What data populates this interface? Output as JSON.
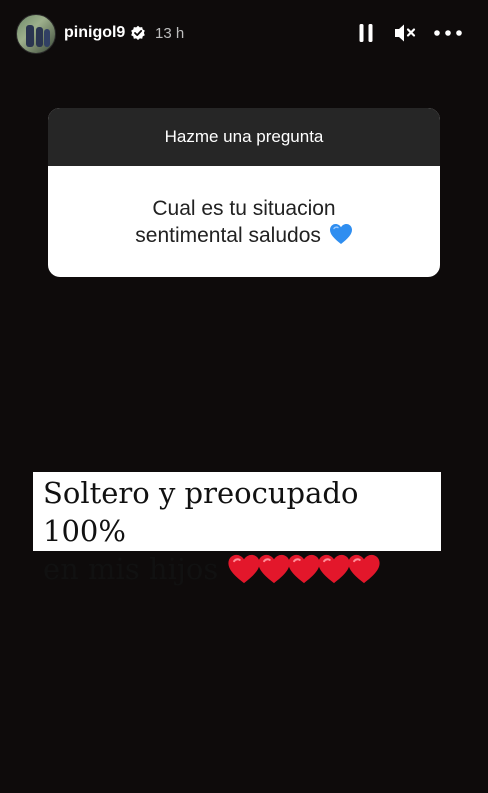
{
  "header": {
    "username": "pinigol9",
    "time": "13 h",
    "icons": [
      "avatar",
      "verified-badge-icon",
      "pause-icon",
      "mute-icon",
      "more-icon"
    ]
  },
  "question": {
    "title": "Hazme una pregunta",
    "text_line1": "Cual es tu situacion",
    "text_line2": "sentimental  saludos",
    "emoji": "blue-heart-icon"
  },
  "answer": {
    "line1": "Soltero y preocupado 100%",
    "line2": "en mis hijos",
    "emoji_count": 5,
    "emoji": "red-heart-icon"
  },
  "colors": {
    "background": "#0e0b0b",
    "sticker_header": "#262626",
    "heart_red": "#e3172b",
    "heart_blue": "#2f8ef0"
  }
}
